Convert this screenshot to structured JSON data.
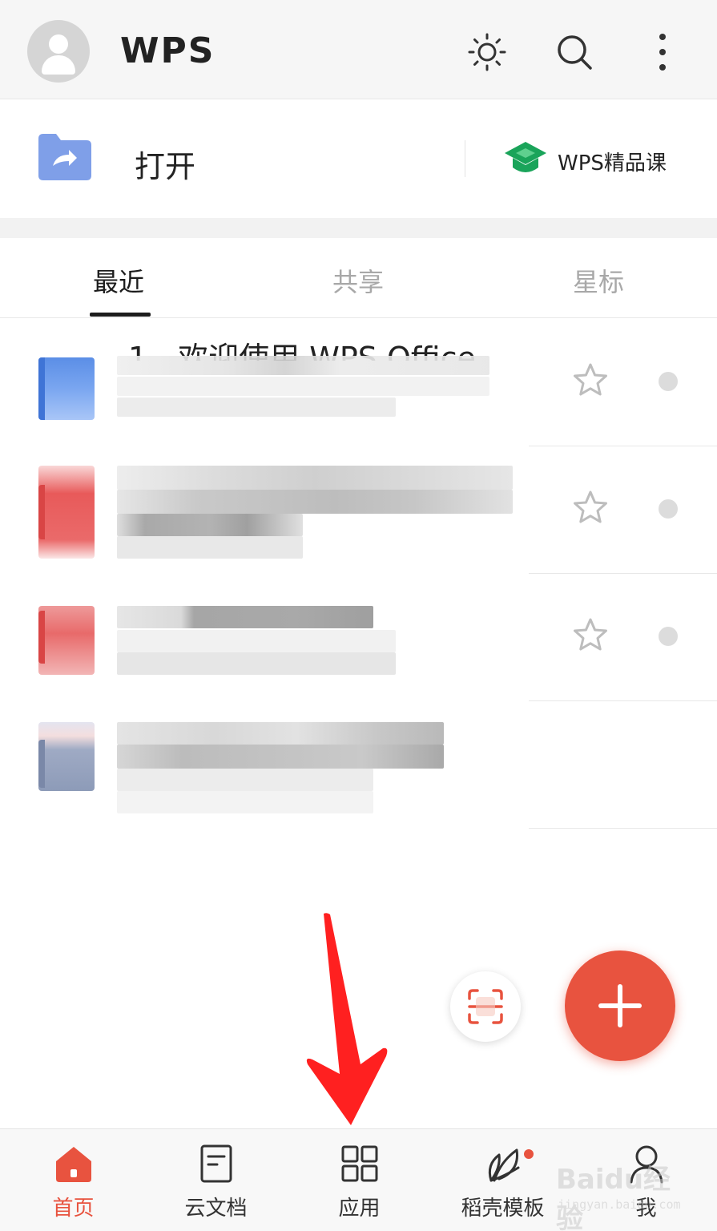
{
  "header": {
    "logo_text": "WPS",
    "icons": [
      "avatar-icon",
      "sun-icon",
      "search-icon",
      "more-vertical-icon"
    ]
  },
  "open_row": {
    "open_label": "打开",
    "course_label": "WPS精品课",
    "colors": {
      "folder": "#7f9fe8",
      "course": "#1aa45a"
    }
  },
  "tabs": [
    {
      "label": "最近",
      "active": true
    },
    {
      "label": "共享",
      "active": false
    },
    {
      "label": "星标",
      "active": false
    }
  ],
  "files": [
    {
      "title": "1、欢迎使用 WPS Office",
      "type": "doc",
      "color": "#5b8ee6",
      "starable": true
    },
    {
      "title": "",
      "type": "pdf",
      "color": "#e85a5a",
      "starable": true
    },
    {
      "title": "",
      "type": "pdf",
      "color": "#e86a6a",
      "starable": true
    },
    {
      "title": "",
      "type": "other",
      "color": "#8d9bb8",
      "starable": false
    }
  ],
  "fab": {
    "icon": "plus-icon",
    "color": "#e8533f"
  },
  "scan": {
    "icon": "scan-icon"
  },
  "bottom_nav": [
    {
      "label": "首页",
      "icon": "home-icon",
      "active": true
    },
    {
      "label": "云文档",
      "icon": "document-icon",
      "active": false
    },
    {
      "label": "应用",
      "icon": "apps-grid-icon",
      "active": false
    },
    {
      "label": "稻壳模板",
      "icon": "leaf-icon",
      "active": false,
      "badge": true
    },
    {
      "label": "我",
      "icon": "user-icon",
      "active": false
    }
  ],
  "watermark": {
    "main": "Baidu经验",
    "sub": "jingyan.baidu.com"
  }
}
